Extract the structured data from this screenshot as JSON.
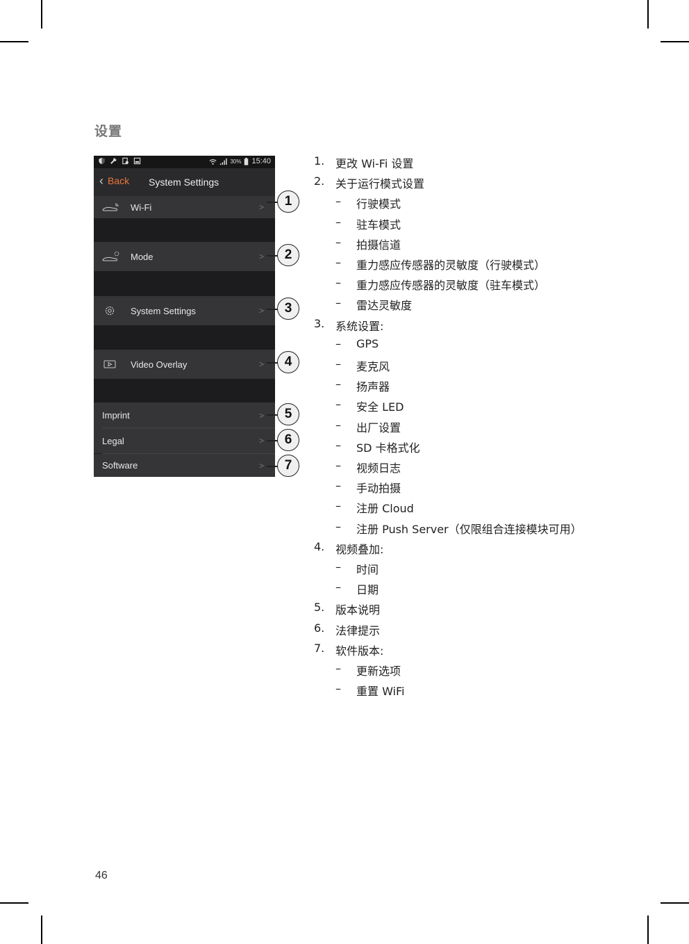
{
  "page": {
    "title": "设置",
    "page_number": "46"
  },
  "phone": {
    "status_bar": {
      "left_icons": [
        "shield-icon",
        "wrench-icon",
        "sd-card-icon",
        "image-icon"
      ],
      "battery": "30%",
      "time": "15:40"
    },
    "nav": {
      "back_label": "Back",
      "title": "System Settings"
    },
    "rows": [
      {
        "label": "Wi-Fi",
        "icon": "car-wifi-icon",
        "callout": "1"
      },
      {
        "label": "Mode",
        "icon": "car-gear-icon",
        "callout": "2"
      },
      {
        "label": "System Settings",
        "icon": "gear-icon",
        "callout": "3"
      },
      {
        "label": "Video Overlay",
        "icon": "video-icon",
        "callout": "4"
      },
      {
        "label": "Imprint",
        "callout": "5"
      },
      {
        "label": "Legal",
        "callout": "6"
      },
      {
        "label": "Software",
        "callout": "7"
      }
    ],
    "arrow": ">"
  },
  "list": {
    "dash": "–",
    "items": [
      {
        "num": "1.",
        "text": "更改 Wi-Fi 设置",
        "subs": []
      },
      {
        "num": "2.",
        "text": "关于运行模式设置",
        "subs": [
          "行驶模式",
          "驻车模式",
          "拍摄信道",
          "重力感应传感器的灵敏度（行驶模式）",
          "重力感应传感器的灵敏度（驻车模式）",
          "雷达灵敏度"
        ]
      },
      {
        "num": "3.",
        "text": "系统设置:",
        "subs": [
          "GPS",
          "麦克风",
          "扬声器",
          "安全 LED",
          "出厂设置",
          "SD 卡格式化",
          "视频日志",
          "手动拍摄",
          "注册 Cloud",
          "注册 Push Server（仅限组合连接模块可用）"
        ]
      },
      {
        "num": "4.",
        "text": "视频叠加:",
        "subs": [
          "时间",
          "日期"
        ]
      },
      {
        "num": "5.",
        "text": "版本说明",
        "subs": []
      },
      {
        "num": "6.",
        "text": "法律提示",
        "subs": []
      },
      {
        "num": "7.",
        "text": "软件版本:",
        "subs": [
          "更新选项",
          "重置 WiFi"
        ]
      }
    ]
  }
}
